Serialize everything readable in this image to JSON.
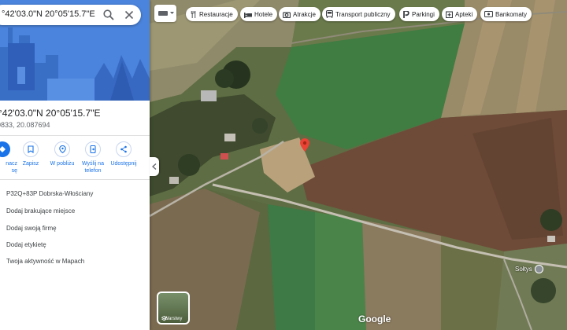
{
  "search": {
    "value": "°42'03.0\"N 20°05'15.7\"E"
  },
  "place": {
    "title": "°42'03.0\"N 20°05'15.7\"E",
    "decimal": "0833, 20.087694"
  },
  "actions": [
    {
      "label": "nacz\nsę",
      "icon": "directions-icon"
    },
    {
      "label": "Zapisz",
      "icon": "bookmark-icon"
    },
    {
      "label": "W pobliżu",
      "icon": "nearby-icon"
    },
    {
      "label": "Wyślij na\ntelefon",
      "icon": "send-to-phone-icon"
    },
    {
      "label": "Udostępnij",
      "icon": "share-icon"
    }
  ],
  "menu": [
    "P32Q+83P Dobrska-Włościany",
    "Dodaj brakujące miejsce",
    "Dodaj swoją firmę",
    "Dodaj etykietę",
    "Twoja aktywność w Mapach"
  ],
  "chips": [
    {
      "label": "Restauracje",
      "icon": "restaurant-icon"
    },
    {
      "label": "Hotele",
      "icon": "hotel-icon"
    },
    {
      "label": "Atrakcje",
      "icon": "camera-icon"
    },
    {
      "label": "Transport publiczny",
      "icon": "transit-icon"
    },
    {
      "label": "Parkingi",
      "icon": "parking-icon"
    },
    {
      "label": "Apteki",
      "icon": "pharmacy-icon"
    },
    {
      "label": "Bankomaty",
      "icon": "atm-icon"
    }
  ],
  "layers_label": "Warstwy",
  "map_label": "Sołtys",
  "brand": "Google",
  "colors": {
    "accent": "#1a73e8",
    "pin": "#ea4335"
  }
}
